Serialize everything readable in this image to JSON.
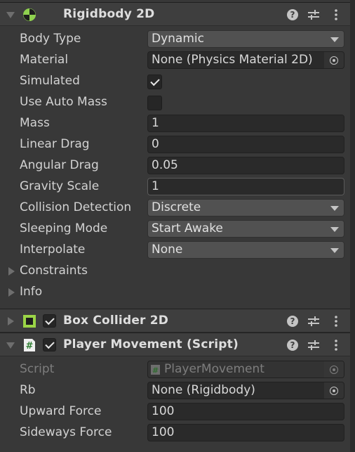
{
  "components": [
    {
      "title": "Rigidbody 2D",
      "expanded": true,
      "has_enable_checkbox": false,
      "icon": "rigidbody2d-icon",
      "properties": [
        {
          "label": "Body Type",
          "type": "dropdown",
          "value": "Dynamic"
        },
        {
          "label": "Material",
          "type": "object",
          "value": "None (Physics Material 2D)"
        },
        {
          "label": "Simulated",
          "type": "checkbox",
          "checked": true
        },
        {
          "label": "Use Auto Mass",
          "type": "checkbox",
          "checked": false
        },
        {
          "label": "Mass",
          "type": "text",
          "value": "1"
        },
        {
          "label": "Linear Drag",
          "type": "text",
          "value": "0"
        },
        {
          "label": "Angular Drag",
          "type": "text",
          "value": "0.05"
        },
        {
          "label": "Gravity Scale",
          "type": "text",
          "value": "1"
        },
        {
          "label": "Collision Detection",
          "type": "dropdown",
          "value": "Discrete"
        },
        {
          "label": "Sleeping Mode",
          "type": "dropdown",
          "value": "Start Awake"
        },
        {
          "label": "Interpolate",
          "type": "dropdown",
          "value": "None"
        }
      ],
      "foldouts": [
        "Constraints",
        "Info"
      ]
    },
    {
      "title": "Box Collider 2D",
      "expanded": false,
      "has_enable_checkbox": true,
      "enabled": true,
      "icon": "box-collider2d-icon"
    },
    {
      "title": "Player Movement (Script)",
      "expanded": true,
      "has_enable_checkbox": true,
      "enabled": true,
      "icon": "csharp-script-icon",
      "properties": [
        {
          "label": "Script",
          "type": "object",
          "value": "PlayerMovement",
          "disabled": true
        },
        {
          "label": "Rb",
          "type": "object",
          "value": "None (Rigidbody)"
        },
        {
          "label": "Upward Force",
          "type": "text",
          "value": "100"
        },
        {
          "label": "Sideways Force",
          "type": "text",
          "value": "100"
        }
      ]
    }
  ],
  "header_buttons": {
    "help": "?",
    "presets": "presets-icon",
    "menu": "kebab-menu-icon"
  },
  "colors": {
    "rigidbody_icon": "#8fd14f",
    "collider_icon": "#9bd547",
    "script_hash": "#2e7d32"
  }
}
